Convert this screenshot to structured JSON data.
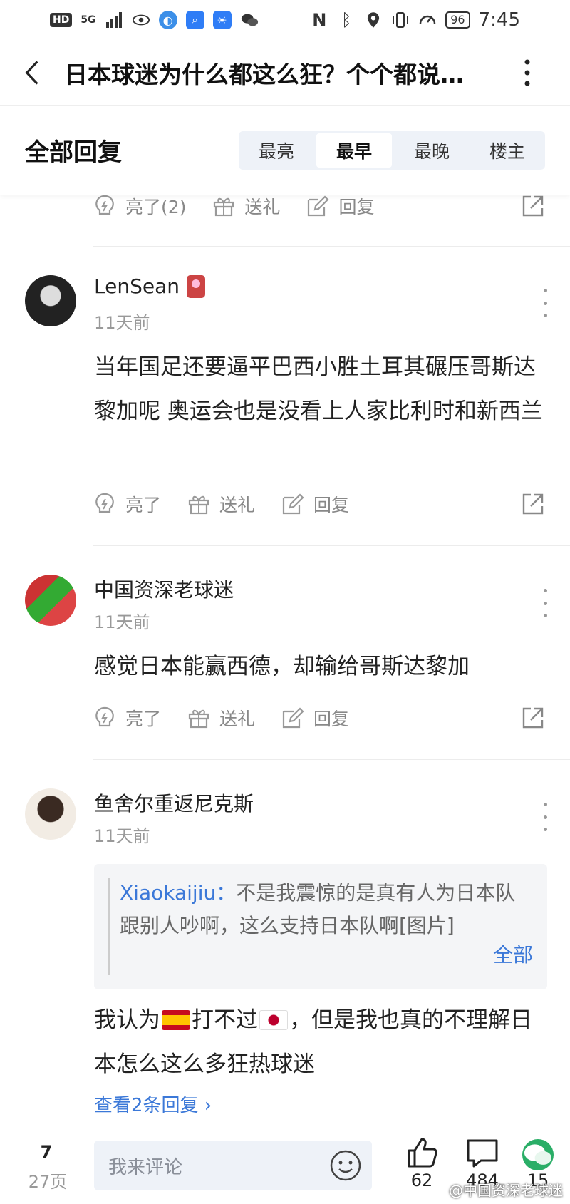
{
  "status_bar": {
    "left_chip": "HD",
    "network": "5G",
    "battery": "96",
    "time": "7:45"
  },
  "header": {
    "title": "日本球迷为什么都这么狂？个个都说…"
  },
  "section": {
    "title": "全部回复",
    "sort_tabs": [
      "最亮",
      "最早",
      "最晚",
      "楼主"
    ],
    "active_tab": "最早"
  },
  "actions": {
    "like_first": "亮了(2)",
    "like": "亮了",
    "gift": "送礼",
    "reply": "回复"
  },
  "comments": [
    {
      "user": "LenSean",
      "time": "11天前",
      "text": "当年国足还要逼平巴西小胜土耳其碾压哥斯达黎加呢 奥运会也是没看上人家比利时和新西兰"
    },
    {
      "user": "中国资深老球迷",
      "time": "11天前",
      "text": "感觉日本能赢西德，却输给哥斯达黎加"
    },
    {
      "user": "鱼舍尔重返尼克斯",
      "time": "11天前",
      "quote_user": "Xiaokaijiu：",
      "quote_text": "不是我震惊的是真有人为日本队跟别人吵啊，这么支持日本队啊[图片]",
      "quote_all": "全部",
      "text_part1": "我认为",
      "text_part2": "打不过",
      "text_part3": "，但是我也真的不理解日本怎么这么多狂热球迷",
      "view_replies": "查看2条回复 ›"
    }
  ],
  "bottom_bar": {
    "page_now": "7",
    "page_total": "27页",
    "input_placeholder": "我来评论",
    "likes": "62",
    "comments": "484",
    "shares": "15",
    "watermark": "@中国资深老球迷"
  },
  "colors": {
    "link_blue": "#3b78d8",
    "tab_bg": "#eef2f8",
    "wechat_green": "#2aae67"
  }
}
